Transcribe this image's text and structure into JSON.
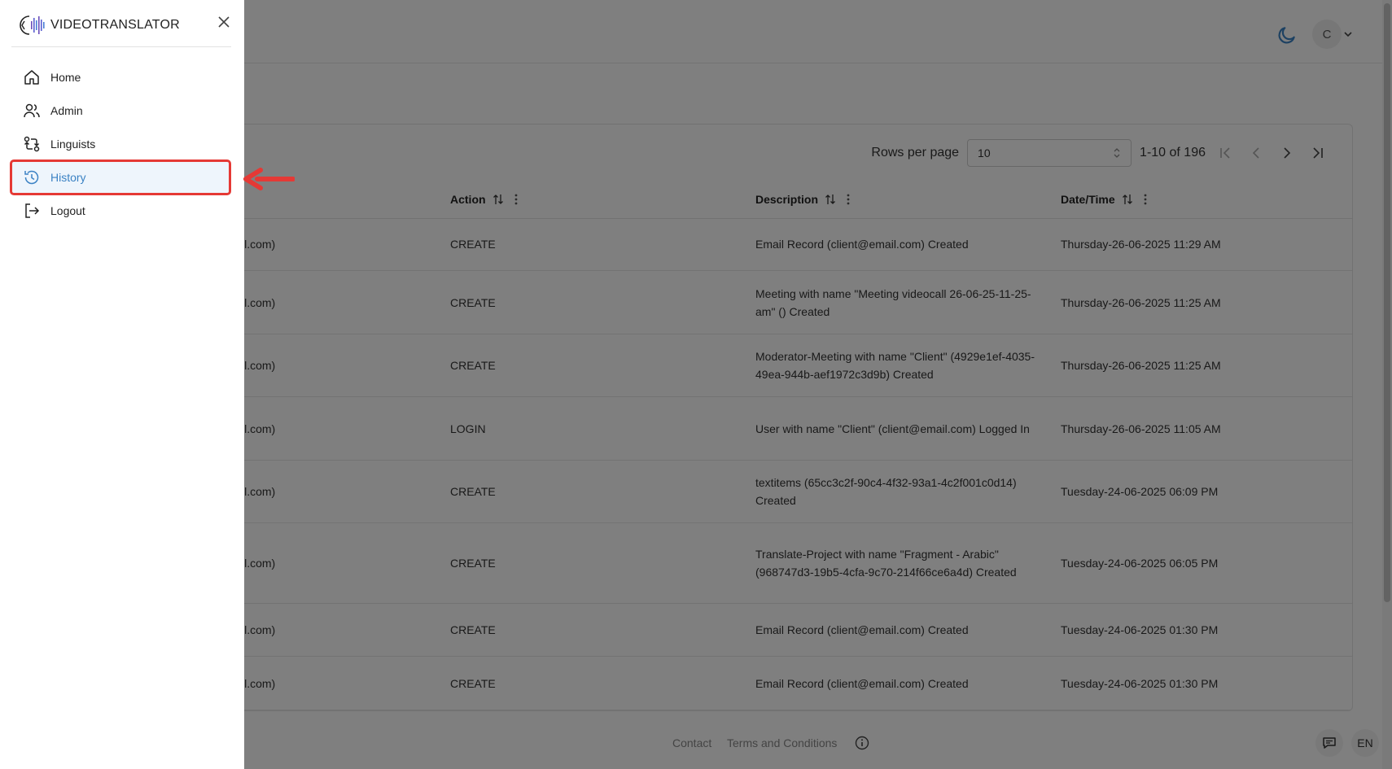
{
  "brand": {
    "name": "VIDEOTRANSLATOR"
  },
  "drawer": {
    "items": [
      {
        "label": "Home",
        "icon": "home-icon"
      },
      {
        "label": "Admin",
        "icon": "users-icon"
      },
      {
        "label": "Linguists",
        "icon": "swap-icon"
      },
      {
        "label": "History",
        "icon": "history-icon",
        "active": true
      },
      {
        "label": "Logout",
        "icon": "logout-icon"
      }
    ]
  },
  "header": {
    "avatar_initial": "C"
  },
  "table": {
    "pagination": {
      "rows_per_page_label": "Rows per page",
      "rows_per_page_value": "10",
      "range": "1-10 of 196"
    },
    "columns": [
      "Action",
      "Description",
      "Date/Time"
    ],
    "rows": [
      {
        "user": "il.com)",
        "action": "CREATE",
        "description": "Email Record (client@email.com) Created",
        "datetime": "Thursday-26-06-2025 11:29 AM"
      },
      {
        "user": "il.com)",
        "action": "CREATE",
        "description": "Meeting with name \"Meeting videocall 26-06-25-11-25-am\" () Created",
        "datetime": "Thursday-26-06-2025 11:25 AM"
      },
      {
        "user": "il.com)",
        "action": "CREATE",
        "description": "Moderator-Meeting with name \"Client\" (4929e1ef-4035-49ea-944b-aef1972c3d9b) Created",
        "datetime": "Thursday-26-06-2025 11:25 AM"
      },
      {
        "user": "il.com)",
        "action": "LOGIN",
        "description": "User with name \"Client\" (client@email.com) Logged In",
        "datetime": "Thursday-26-06-2025 11:05 AM"
      },
      {
        "user": "il.com)",
        "action": "CREATE",
        "description": "textitems (65cc3c2f-90c4-4f32-93a1-4c2f001c0d14) Created",
        "datetime": "Tuesday-24-06-2025 06:09 PM"
      },
      {
        "user": "il.com)",
        "action": "CREATE",
        "description": "Translate-Project with name \"Fragment - Arabic\" (968747d3-19b5-4cfa-9c70-214f66ce6a4d) Created",
        "datetime": "Tuesday-24-06-2025 06:05 PM"
      },
      {
        "user": "il.com)",
        "action": "CREATE",
        "description": "Email Record (client@email.com) Created",
        "datetime": "Tuesday-24-06-2025 01:30 PM"
      },
      {
        "user": "il.com)",
        "action": "CREATE",
        "description": "Email Record (client@email.com) Created",
        "datetime": "Tuesday-24-06-2025 01:30 PM"
      }
    ]
  },
  "footer": {
    "contact": "Contact",
    "terms": "Terms and Conditions",
    "lang": "EN"
  },
  "colors": {
    "overlay": "#000000",
    "active_border": "#e53935",
    "active_text": "#3b82c4",
    "arrow": "#e53935"
  }
}
